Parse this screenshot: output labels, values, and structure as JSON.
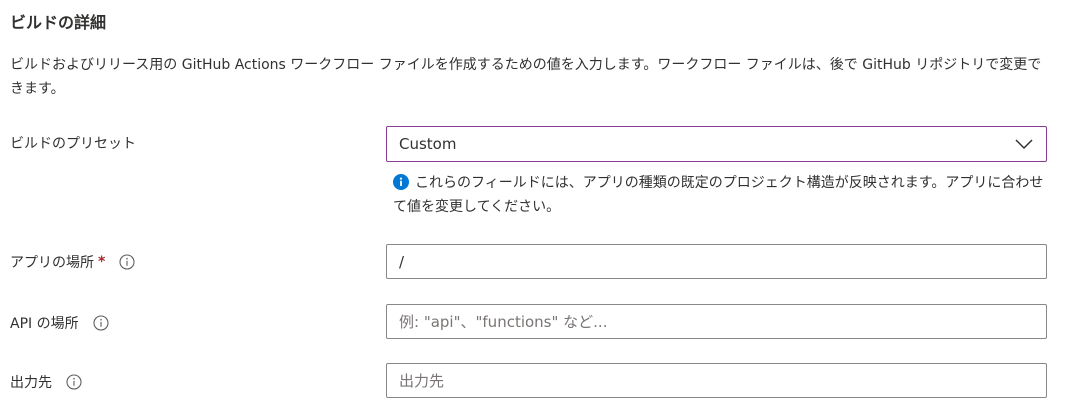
{
  "section": {
    "title": "ビルドの詳細",
    "description": "ビルドおよびリリース用の GitHub Actions ワークフロー ファイルを作成するための値を入力します。ワークフロー ファイルは、後で GitHub リポジトリで変更できます。"
  },
  "preset": {
    "label": "ビルドのプリセット",
    "value": "Custom",
    "icon": "chevron-down-icon",
    "hint": "これらのフィールドには、アプリの種類の既定のプロジェクト構造が反映されます。アプリに合わせて値を変更してください。",
    "hint_icon": "info-filled-icon"
  },
  "app_location": {
    "label": "アプリの場所",
    "required_mark": "*",
    "value": "/",
    "icon": "info-icon"
  },
  "api_location": {
    "label": "API の場所",
    "placeholder": "例: \"api\"、\"functions\" など...",
    "icon": "info-icon"
  },
  "output_location": {
    "label": "出力先",
    "placeholder": "出力先",
    "icon": "info-icon"
  },
  "colors": {
    "accent": "#8a3b96",
    "info": "#0078d4",
    "required": "#a4262c"
  }
}
